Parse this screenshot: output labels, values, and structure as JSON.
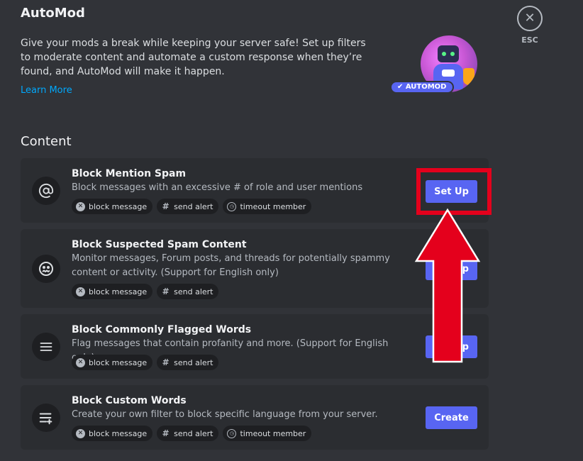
{
  "header": {
    "title": "AutoMod",
    "description": "Give your mods a break while keeping your server safe! Set up filters to moderate content and automate a custom response when they’re found, and AutoMod will make it happen.",
    "learn_more": "Learn More",
    "badge": "✔ AUTOMOD",
    "close_label": "ESC"
  },
  "section": {
    "heading": "Content"
  },
  "rules": [
    {
      "title": "Block Mention Spam",
      "description": "Block messages with an excessive # of role and user mentions",
      "icon": "at-sign-icon",
      "actions": [
        "block message",
        "send alert",
        "timeout member"
      ],
      "button": "Set Up"
    },
    {
      "title": "Block Suspected Spam Content",
      "description": "Monitor messages, Forum posts, and threads for potentially spammy content or activity. (Support for English only)",
      "icon": "spam-face-icon",
      "actions": [
        "block message",
        "send alert"
      ],
      "button": "Set Up"
    },
    {
      "title": "Block Commonly Flagged Words",
      "description": "Flag messages that contain profanity and more. (Support for English only)",
      "icon": "list-icon",
      "actions": [
        "block message",
        "send alert"
      ],
      "button": "Set Up"
    },
    {
      "title": "Block Custom Words",
      "description": "Create your own filter to block specific language from your server.",
      "icon": "list-add-icon",
      "actions": [
        "block message",
        "send alert",
        "timeout member"
      ],
      "button": "Create"
    }
  ],
  "colors": {
    "background": "#313338",
    "card": "#2b2d31",
    "accent": "#5865f2",
    "link": "#00a8fc",
    "annotation": "#e4001c"
  }
}
